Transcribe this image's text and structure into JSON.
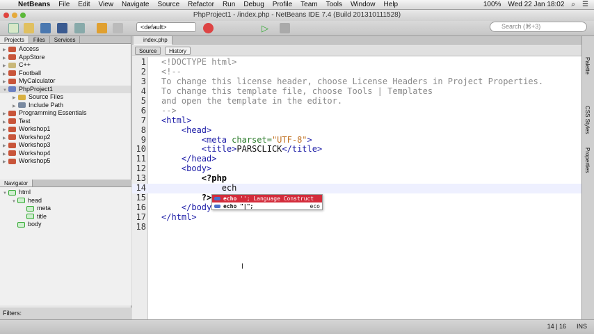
{
  "menubar": {
    "app": "NetBeans",
    "items": [
      "File",
      "Edit",
      "View",
      "Navigate",
      "Source",
      "Refactor",
      "Run",
      "Debug",
      "Profile",
      "Team",
      "Tools",
      "Window",
      "Help"
    ],
    "battery": "100%",
    "clock": "Wed 22 Jan  18:02"
  },
  "window": {
    "title": "PhpProject1 - /index.php - NetBeans IDE 7.4 (Build 201310111528)"
  },
  "toolbar": {
    "config": "<default>",
    "search_placeholder": "Search (⌘+3)"
  },
  "projects": {
    "tabs": [
      "Projects",
      "Files",
      "Services"
    ],
    "items": [
      {
        "label": "Access",
        "level": 0,
        "icon": "coffee"
      },
      {
        "label": "AppStore",
        "level": 0,
        "icon": "coffee"
      },
      {
        "label": "C++",
        "level": 0,
        "icon": "cpp"
      },
      {
        "label": "Football",
        "level": 0,
        "icon": "coffee"
      },
      {
        "label": "MyCalculator",
        "level": 0,
        "icon": "coffee"
      },
      {
        "label": "PhpProject1",
        "level": 0,
        "icon": "php",
        "expanded": true
      },
      {
        "label": "Source Files",
        "level": 1,
        "icon": "folder"
      },
      {
        "label": "Include Path",
        "level": 1,
        "icon": "lib"
      },
      {
        "label": "Programming Essentials",
        "level": 0,
        "icon": "coffee"
      },
      {
        "label": "Test",
        "level": 0,
        "icon": "coffee"
      },
      {
        "label": "Workshop1",
        "level": 0,
        "icon": "coffee"
      },
      {
        "label": "Workshop2",
        "level": 0,
        "icon": "coffee"
      },
      {
        "label": "Workshop3",
        "level": 0,
        "icon": "coffee"
      },
      {
        "label": "Workshop4",
        "level": 0,
        "icon": "coffee"
      },
      {
        "label": "Workshop5",
        "level": 0,
        "icon": "coffee"
      }
    ]
  },
  "navigator": {
    "title": "Navigator",
    "items": [
      {
        "label": "html",
        "level": 0,
        "expanded": true
      },
      {
        "label": "head",
        "level": 1,
        "expanded": true
      },
      {
        "label": "meta",
        "level": 2
      },
      {
        "label": "title",
        "level": 2
      },
      {
        "label": "body",
        "level": 1
      }
    ],
    "filters_label": "Filters:"
  },
  "editor": {
    "tab": "index.php",
    "source_btn": "Source",
    "history_btn": "History",
    "current_line": 14,
    "lines": [
      [
        {
          "t": "<!DOCTYPE html>",
          "c": "com"
        }
      ],
      [
        {
          "t": "<!--",
          "c": "com"
        }
      ],
      [
        {
          "t": "To change this license header, choose License Headers in Project Properties.",
          "c": "com"
        }
      ],
      [
        {
          "t": "To change this template file, choose Tools | Templates",
          "c": "com"
        }
      ],
      [
        {
          "t": "and open the template in the editor.",
          "c": "com"
        }
      ],
      [
        {
          "t": "-->",
          "c": "com"
        }
      ],
      [
        {
          "t": "<html>",
          "c": "tag"
        }
      ],
      [
        {
          "t": "    <head>",
          "c": "tag"
        }
      ],
      [
        {
          "t": "        <meta ",
          "c": "tag"
        },
        {
          "t": "charset=",
          "c": "attr"
        },
        {
          "t": "\"UTF-8\"",
          "c": "str"
        },
        {
          "t": ">",
          "c": "tag"
        }
      ],
      [
        {
          "t": "        <title>",
          "c": "tag"
        },
        {
          "t": "PARSCLICK",
          "c": "plain"
        },
        {
          "t": "</title>",
          "c": "tag"
        }
      ],
      [
        {
          "t": "    </head>",
          "c": "tag"
        }
      ],
      [
        {
          "t": "    <body>",
          "c": "tag"
        }
      ],
      [
        {
          "t": "        <?php",
          "c": "php"
        }
      ],
      [
        {
          "t": "            ech",
          "c": "plain"
        }
      ],
      [
        {
          "t": "        ?>",
          "c": "php"
        }
      ],
      [
        {
          "t": "    </body>",
          "c": "tag"
        }
      ],
      [
        {
          "t": "</html>",
          "c": "tag"
        }
      ],
      []
    ]
  },
  "completion": {
    "items": [
      {
        "keyword": "echo",
        "detail": " '';  Language Construct",
        "right": ""
      },
      {
        "keyword": "echo \"|\";",
        "detail": "",
        "right": "eco"
      }
    ]
  },
  "right_panels": [
    "Palette",
    "CSS Styles",
    "Properties"
  ],
  "status": {
    "position": "14 | 16",
    "mode": "INS"
  },
  "cursor_glyph": "I"
}
